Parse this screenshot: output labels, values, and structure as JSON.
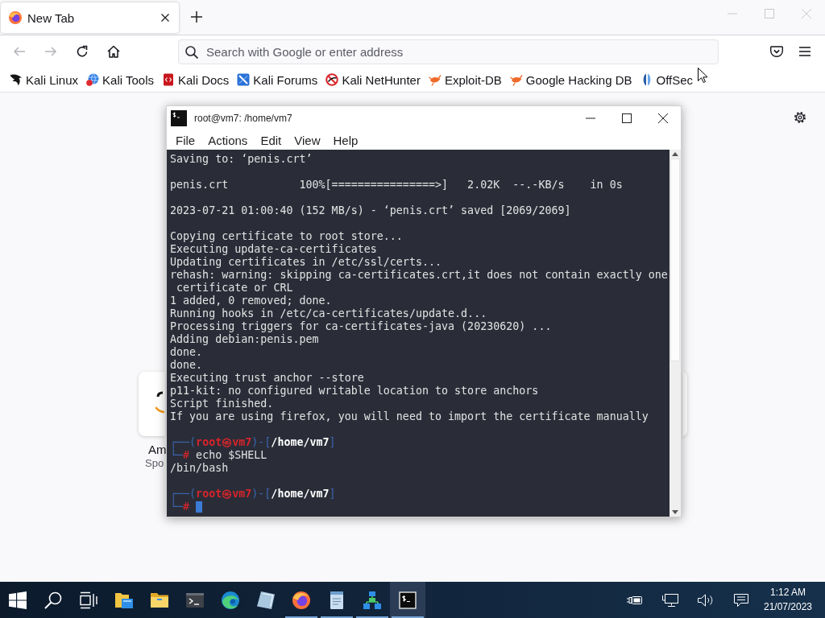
{
  "browser": {
    "focused": false,
    "tabs": [
      {
        "title": "New Tab",
        "selected": true
      }
    ],
    "nav_buttons": [
      {
        "kind": "back",
        "disabled": true
      },
      {
        "kind": "forward",
        "disabled": true
      },
      {
        "kind": "reload",
        "disabled": false
      },
      {
        "kind": "home",
        "disabled": false
      }
    ],
    "address_bar": {
      "placeholder": "Search with Google or enter address"
    },
    "toolbar_buttons": [
      {
        "kind": "pocket"
      },
      {
        "kind": "menu"
      }
    ],
    "bookmarks": [
      {
        "label": "Kali Linux",
        "kind": "dragon"
      },
      {
        "label": "Kali Tools",
        "kind": "globe"
      },
      {
        "label": "Kali Docs",
        "kind": "docs"
      },
      {
        "label": "Kali Forums",
        "kind": "forums"
      },
      {
        "label": "Kali NetHunter",
        "kind": "nethunter"
      },
      {
        "label": "Exploit-DB",
        "kind": "bug"
      },
      {
        "label": "Google Hacking DB",
        "kind": "bug"
      },
      {
        "label": "OffSec",
        "kind": "offsec"
      }
    ],
    "top_sites": [
      {
        "title": "Am",
        "label": "Spo"
      }
    ]
  },
  "terminal": {
    "title": "root@vm7: /home/vm7",
    "focused": true,
    "menu": [
      "File",
      "Actions",
      "Edit",
      "View",
      "Help"
    ],
    "lines": [
      {
        "kind": "output",
        "text": "Saving to: ‘penis.crt’"
      },
      {
        "kind": "blank"
      },
      {
        "kind": "output",
        "text": "penis.crt           100%[================>]   2.02K  --.-KB/s    in 0s"
      },
      {
        "kind": "blank"
      },
      {
        "kind": "output",
        "text": "2023-07-21 01:00:40 (152 MB/s) - ‘penis.crt’ saved [2069/2069]"
      },
      {
        "kind": "blank"
      },
      {
        "kind": "output",
        "text": "Copying certificate to root store..."
      },
      {
        "kind": "output",
        "text": "Executing update-ca-certificates"
      },
      {
        "kind": "output",
        "text": "Updating certificates in /etc/ssl/certs..."
      },
      {
        "kind": "output",
        "text": "rehash: warning: skipping ca-certificates.crt,it does not contain exactly one"
      },
      {
        "kind": "output",
        "text": " certificate or CRL"
      },
      {
        "kind": "output",
        "text": "1 added, 0 removed; done."
      },
      {
        "kind": "output",
        "text": "Running hooks in /etc/ca-certificates/update.d..."
      },
      {
        "kind": "output",
        "text": "Processing triggers for ca-certificates-java (20230620) ..."
      },
      {
        "kind": "output",
        "text": "Adding debian:penis.pem"
      },
      {
        "kind": "output",
        "text": "done."
      },
      {
        "kind": "output",
        "text": "done."
      },
      {
        "kind": "output",
        "text": "Executing trust anchor --store"
      },
      {
        "kind": "output",
        "text": "p11-kit: no configured writable location to store anchors"
      },
      {
        "kind": "output",
        "text": "Script finished."
      },
      {
        "kind": "output",
        "text": "If you are using firefox, you will need to import the certificate manually"
      },
      {
        "kind": "blank"
      },
      {
        "kind": "prompt",
        "cursor": false,
        "segments": [
          {
            "kind": "frame",
            "text": "┌──("
          },
          {
            "kind": "user",
            "text": "root㉿vm7"
          },
          {
            "kind": "frame",
            "text": ")-["
          },
          {
            "kind": "path",
            "text": "/home/vm7"
          },
          {
            "kind": "frame",
            "text": "]"
          }
        ]
      },
      {
        "kind": "prompt",
        "cursor": false,
        "segments": [
          {
            "kind": "frame",
            "text": "└─"
          },
          {
            "kind": "hash",
            "text": "#"
          },
          {
            "kind": "plain",
            "text": " echo $SHELL"
          }
        ]
      },
      {
        "kind": "output",
        "text": "/bin/bash"
      },
      {
        "kind": "blank"
      },
      {
        "kind": "prompt",
        "cursor": false,
        "segments": [
          {
            "kind": "frame",
            "text": "┌──("
          },
          {
            "kind": "user",
            "text": "root㉿vm7"
          },
          {
            "kind": "frame",
            "text": ")-["
          },
          {
            "kind": "path",
            "text": "/home/vm7"
          },
          {
            "kind": "frame",
            "text": "]"
          }
        ]
      },
      {
        "kind": "prompt",
        "cursor": true,
        "segments": [
          {
            "kind": "frame",
            "text": "└─"
          },
          {
            "kind": "hash",
            "text": "#"
          }
        ]
      }
    ]
  },
  "taskbar": {
    "buttons": [
      {
        "kind": "start"
      },
      {
        "kind": "search"
      },
      {
        "kind": "task_view"
      }
    ],
    "apps": [
      {
        "kind": "files",
        "running": false,
        "selected": false
      },
      {
        "kind": "folder",
        "running": false,
        "selected": false
      },
      {
        "kind": "console",
        "running": false,
        "selected": false
      },
      {
        "kind": "edge",
        "running": false,
        "selected": false
      },
      {
        "kind": "viewer",
        "running": false,
        "selected": false
      },
      {
        "kind": "firefox",
        "running": true,
        "selected": false
      },
      {
        "kind": "notepad",
        "running": true,
        "selected": false
      },
      {
        "kind": "grid",
        "running": true,
        "selected": false
      },
      {
        "kind": "terminal",
        "running": true,
        "selected": true
      }
    ],
    "tray": [
      {
        "kind": "power"
      },
      {
        "kind": "network"
      },
      {
        "kind": "volume"
      },
      {
        "kind": "notifications"
      }
    ],
    "clock": {
      "time": "1:12 AM",
      "date": "21/07/2023"
    }
  }
}
